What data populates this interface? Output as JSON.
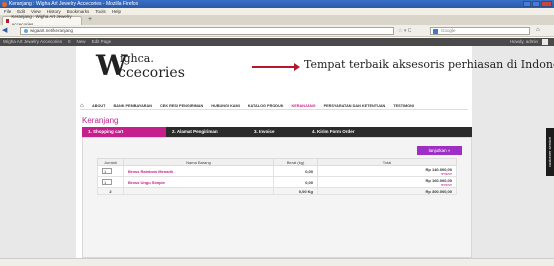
{
  "window": {
    "title": "Keranjang : Wigha Art Jewelry Accecories - Mozilla Firefox"
  },
  "menu": [
    "File",
    "Edit",
    "View",
    "History",
    "Bookmarks",
    "Tools",
    "Help"
  ],
  "tab": {
    "label": "Keranjang : Wigha Art Jewelry Accecories",
    "new_tab": "+"
  },
  "address": {
    "url": "wigaart.net/keranjang",
    "search_placeholder": "Google"
  },
  "bookmarks": [
    "Wigha Art Jewelry Accecories",
    "0",
    "New",
    "Edit Page"
  ],
  "bookmarks_right": "Howdy, admin",
  "site": {
    "logo_letter": "W",
    "logo_top": "ighca.",
    "logo_bottom": "ccecories",
    "tagline": "Tempat terbaik aksesoris perhiasan di Indonesia",
    "nav": [
      "ABOUT",
      "BANK PEMBAYARAN",
      "CEK RESI PENGIRIMAN",
      "HUBUNGI KAMI",
      "KATALOG PRODUK",
      "KERANJANG",
      "PERSYARATAN DAN KETENTUAN",
      "TESTIMONI"
    ],
    "active_nav": "KERANJANG"
  },
  "page": {
    "heading": "Keranjang"
  },
  "steps": [
    "1. Shopping cart",
    "2. Alamat Pengiriman",
    "3. Invoice",
    "4. Kirim Form Order"
  ],
  "continue_button": "lanjutkan »",
  "cart": {
    "headers": [
      "Jumlah",
      "Nama Barang",
      "Berat (kg)",
      "Total"
    ],
    "rows": [
      {
        "qty": "1",
        "name": "Bross Rainbow Menarik",
        "weight": "0,00",
        "total": "Rp 140.000,00",
        "remove": "remove"
      },
      {
        "qty": "1",
        "name": "Bross Ungu Simple",
        "weight": "0,00",
        "total": "Rp 160.000,00",
        "remove": "remove"
      }
    ],
    "summary": {
      "qty": "2",
      "weight": "0,00 Kg",
      "total": "Rp 300.000,00"
    }
  },
  "side_tab": "customer service"
}
